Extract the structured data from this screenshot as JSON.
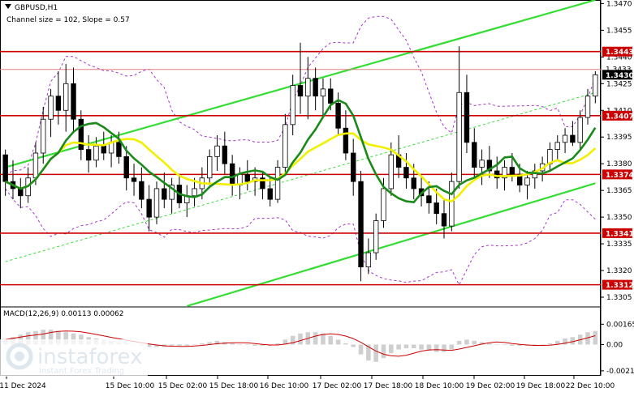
{
  "header": {
    "symbol": "GBPUSD,H1",
    "channel_info": "Channel size = 102, Slope = 0.57"
  },
  "macd_label": "MACD(12,26,9) 0.00113 0.00062",
  "logo": {
    "brand": "instaforex",
    "tagline": "Instant Forex Trading"
  },
  "colors": {
    "candle": "#000000",
    "level_line": "#cc0000",
    "level_label_bg": "#cc0000",
    "channel": "#33dd33",
    "ma_fast": "#1a8a1a",
    "ma_slow": "#f0f000",
    "bollinger": "#aa33cc",
    "macd_hist": "#cfcfcf",
    "macd_signal": "#cc0000",
    "current_price_bg": "#000000"
  },
  "chart_data": {
    "type": "candlestick",
    "price_axis_ticks": [
      "1.3470",
      "1.3455",
      "1.3440",
      "1.3425",
      "1.3410",
      "1.3395",
      "1.3380",
      "1.3365",
      "1.3350",
      "1.3335",
      "1.3320",
      "1.3305"
    ],
    "price_axis_values": [
      1.347,
      1.3455,
      1.344,
      1.3425,
      1.341,
      1.3395,
      1.338,
      1.3365,
      1.335,
      1.3335,
      1.332,
      1.3305
    ],
    "ylim": [
      1.33,
      1.3472
    ],
    "time_labels": [
      "11 Dec 2024",
      "15 Dec 10:00",
      "15 Dec 02:00",
      "15 Dec 18:00",
      "16 Dec 10:00",
      "17 Dec 02:00",
      "17 Dec 18:00",
      "18 Dec 10:00",
      "19 Dec 02:00",
      "19 Dec 18:00",
      "22 Dec 10:00"
    ],
    "levels": [
      {
        "label": "1.3443",
        "value": 1.3443
      },
      {
        "label": "1.3407",
        "value": 1.3407
      },
      {
        "label": "1.3374",
        "value": 1.3374
      },
      {
        "label": "1.3341",
        "value": 1.3341
      },
      {
        "label": "1.3312",
        "value": 1.3312
      }
    ],
    "current_price": {
      "label": "1.3430",
      "value": 1.343
    },
    "ask_price": {
      "label": "1.3433",
      "value": 1.3433
    },
    "candles": [
      [
        1.3385,
        1.3388,
        1.3362,
        1.337
      ],
      [
        1.337,
        1.3382,
        1.336,
        1.3366
      ],
      [
        1.3366,
        1.3372,
        1.3355,
        1.3362
      ],
      [
        1.3362,
        1.3378,
        1.3358,
        1.3372
      ],
      [
        1.3372,
        1.3392,
        1.3368,
        1.3386
      ],
      [
        1.3386,
        1.3412,
        1.338,
        1.3405
      ],
      [
        1.3405,
        1.3422,
        1.3395,
        1.3418
      ],
      [
        1.3418,
        1.3432,
        1.3402,
        1.341
      ],
      [
        1.341,
        1.3436,
        1.3398,
        1.3425
      ],
      [
        1.3425,
        1.3434,
        1.3398,
        1.3405
      ],
      [
        1.3405,
        1.341,
        1.3382,
        1.3388
      ],
      [
        1.3388,
        1.3396,
        1.3375,
        1.3382
      ],
      [
        1.3382,
        1.3395,
        1.3378,
        1.339
      ],
      [
        1.339,
        1.3398,
        1.3382,
        1.3386
      ],
      [
        1.3386,
        1.3396,
        1.3378,
        1.3392
      ],
      [
        1.3392,
        1.3398,
        1.338,
        1.3384
      ],
      [
        1.3384,
        1.339,
        1.3365,
        1.3372
      ],
      [
        1.3372,
        1.338,
        1.3362,
        1.337
      ],
      [
        1.337,
        1.3378,
        1.3355,
        1.336
      ],
      [
        1.336,
        1.3368,
        1.3342,
        1.335
      ],
      [
        1.335,
        1.337,
        1.3346,
        1.3366
      ],
      [
        1.3366,
        1.3375,
        1.3355,
        1.336
      ],
      [
        1.336,
        1.3372,
        1.3352,
        1.3368
      ],
      [
        1.3368,
        1.3374,
        1.3355,
        1.3358
      ],
      [
        1.3358,
        1.3368,
        1.335,
        1.3362
      ],
      [
        1.3362,
        1.3372,
        1.3356,
        1.3366
      ],
      [
        1.3366,
        1.3378,
        1.336,
        1.3372
      ],
      [
        1.3372,
        1.3388,
        1.3368,
        1.3384
      ],
      [
        1.3384,
        1.3396,
        1.3376,
        1.339
      ],
      [
        1.339,
        1.3398,
        1.3374,
        1.338
      ],
      [
        1.338,
        1.3385,
        1.3362,
        1.3368
      ],
      [
        1.3368,
        1.3378,
        1.336,
        1.3374
      ],
      [
        1.3374,
        1.3382,
        1.3365,
        1.337
      ],
      [
        1.337,
        1.3378,
        1.3362,
        1.3372
      ],
      [
        1.3372,
        1.3376,
        1.336,
        1.3366
      ],
      [
        1.3366,
        1.3372,
        1.3356,
        1.336
      ],
      [
        1.336,
        1.3382,
        1.3358,
        1.3378
      ],
      [
        1.3378,
        1.3408,
        1.3374,
        1.3402
      ],
      [
        1.3402,
        1.343,
        1.3396,
        1.3424
      ],
      [
        1.3424,
        1.3448,
        1.3408,
        1.3418
      ],
      [
        1.3418,
        1.344,
        1.3405,
        1.3428
      ],
      [
        1.3428,
        1.3434,
        1.341,
        1.3418
      ],
      [
        1.3418,
        1.3428,
        1.3406,
        1.3422
      ],
      [
        1.3422,
        1.3428,
        1.341,
        1.3414
      ],
      [
        1.3414,
        1.342,
        1.3396,
        1.34
      ],
      [
        1.34,
        1.341,
        1.3382,
        1.3386
      ],
      [
        1.3386,
        1.3394,
        1.3362,
        1.337
      ],
      [
        1.337,
        1.3376,
        1.3314,
        1.3322
      ],
      [
        1.3322,
        1.3338,
        1.3318,
        1.333
      ],
      [
        1.333,
        1.3352,
        1.3326,
        1.3348
      ],
      [
        1.3348,
        1.3372,
        1.3344,
        1.3366
      ],
      [
        1.3366,
        1.3392,
        1.3362,
        1.3385
      ],
      [
        1.3385,
        1.3396,
        1.3372,
        1.3378
      ],
      [
        1.3378,
        1.3386,
        1.3366,
        1.3372
      ],
      [
        1.3372,
        1.338,
        1.336,
        1.3366
      ],
      [
        1.3366,
        1.3374,
        1.3356,
        1.3362
      ],
      [
        1.3362,
        1.337,
        1.3352,
        1.3358
      ],
      [
        1.3358,
        1.3366,
        1.3346,
        1.3352
      ],
      [
        1.3352,
        1.336,
        1.3338,
        1.3345
      ],
      [
        1.3345,
        1.3375,
        1.3342,
        1.337
      ],
      [
        1.337,
        1.3446,
        1.3366,
        1.342
      ],
      [
        1.342,
        1.343,
        1.3386,
        1.3392
      ],
      [
        1.3392,
        1.34,
        1.3372,
        1.3378
      ],
      [
        1.3378,
        1.3388,
        1.3368,
        1.3382
      ],
      [
        1.3382,
        1.339,
        1.3372,
        1.3376
      ],
      [
        1.3376,
        1.3384,
        1.3366,
        1.3372
      ],
      [
        1.3372,
        1.3382,
        1.3365,
        1.3378
      ],
      [
        1.3378,
        1.3386,
        1.337,
        1.3374
      ],
      [
        1.3374,
        1.338,
        1.3364,
        1.3368
      ],
      [
        1.3368,
        1.3376,
        1.336,
        1.3372
      ],
      [
        1.3372,
        1.338,
        1.3366,
        1.3376
      ],
      [
        1.3376,
        1.3384,
        1.337,
        1.338
      ],
      [
        1.338,
        1.3392,
        1.3376,
        1.3388
      ],
      [
        1.3388,
        1.3396,
        1.3382,
        1.3392
      ],
      [
        1.3392,
        1.34,
        1.3386,
        1.3396
      ],
      [
        1.3396,
        1.3404,
        1.339,
        1.3392
      ],
      [
        1.3392,
        1.341,
        1.3388,
        1.3406
      ],
      [
        1.3406,
        1.3422,
        1.3402,
        1.3418
      ],
      [
        1.3418,
        1.3432,
        1.3414,
        1.343
      ]
    ],
    "macd_axis_ticks": [
      "0.00165",
      "0.00",
      "-0.00213"
    ],
    "macd_axis_values": [
      0.00165,
      0.0,
      -0.00213
    ],
    "macd_ylim": [
      -0.0024,
      0.002
    ],
    "macd_hist": [
      0.0004,
      0.0006,
      0.0008,
      0.001,
      0.0011,
      0.0012,
      0.0012,
      0.0011,
      0.001,
      0.0009,
      0.0008,
      0.0006,
      0.0005,
      0.0004,
      0.0003,
      0.0002,
      0.0001,
      0.0,
      -0.0001,
      -0.0002,
      -0.0002,
      -0.0002,
      -0.0001,
      -0.0001,
      -0.0001,
      0.0,
      0.0001,
      0.0002,
      0.0003,
      0.0002,
      0.0001,
      0.0,
      0.0,
      -0.0001,
      -0.0001,
      -0.0001,
      0.0001,
      0.0004,
      0.0007,
      0.0009,
      0.001,
      0.001,
      0.0009,
      0.0007,
      0.0004,
      0.0001,
      -0.0002,
      -0.0008,
      -0.0013,
      -0.0014,
      -0.0011,
      -0.0007,
      -0.0004,
      -0.0003,
      -0.0003,
      -0.0004,
      -0.0005,
      -0.0006,
      -0.0006,
      -0.0004,
      0.0003,
      0.0004,
      0.0003,
      0.0002,
      0.0001,
      0.0,
      0.0,
      -0.0001,
      -0.0001,
      -0.0001,
      -0.0001,
      0.0,
      0.0001,
      0.0003,
      0.0005,
      0.0006,
      0.0008,
      0.001,
      0.0011
    ]
  }
}
